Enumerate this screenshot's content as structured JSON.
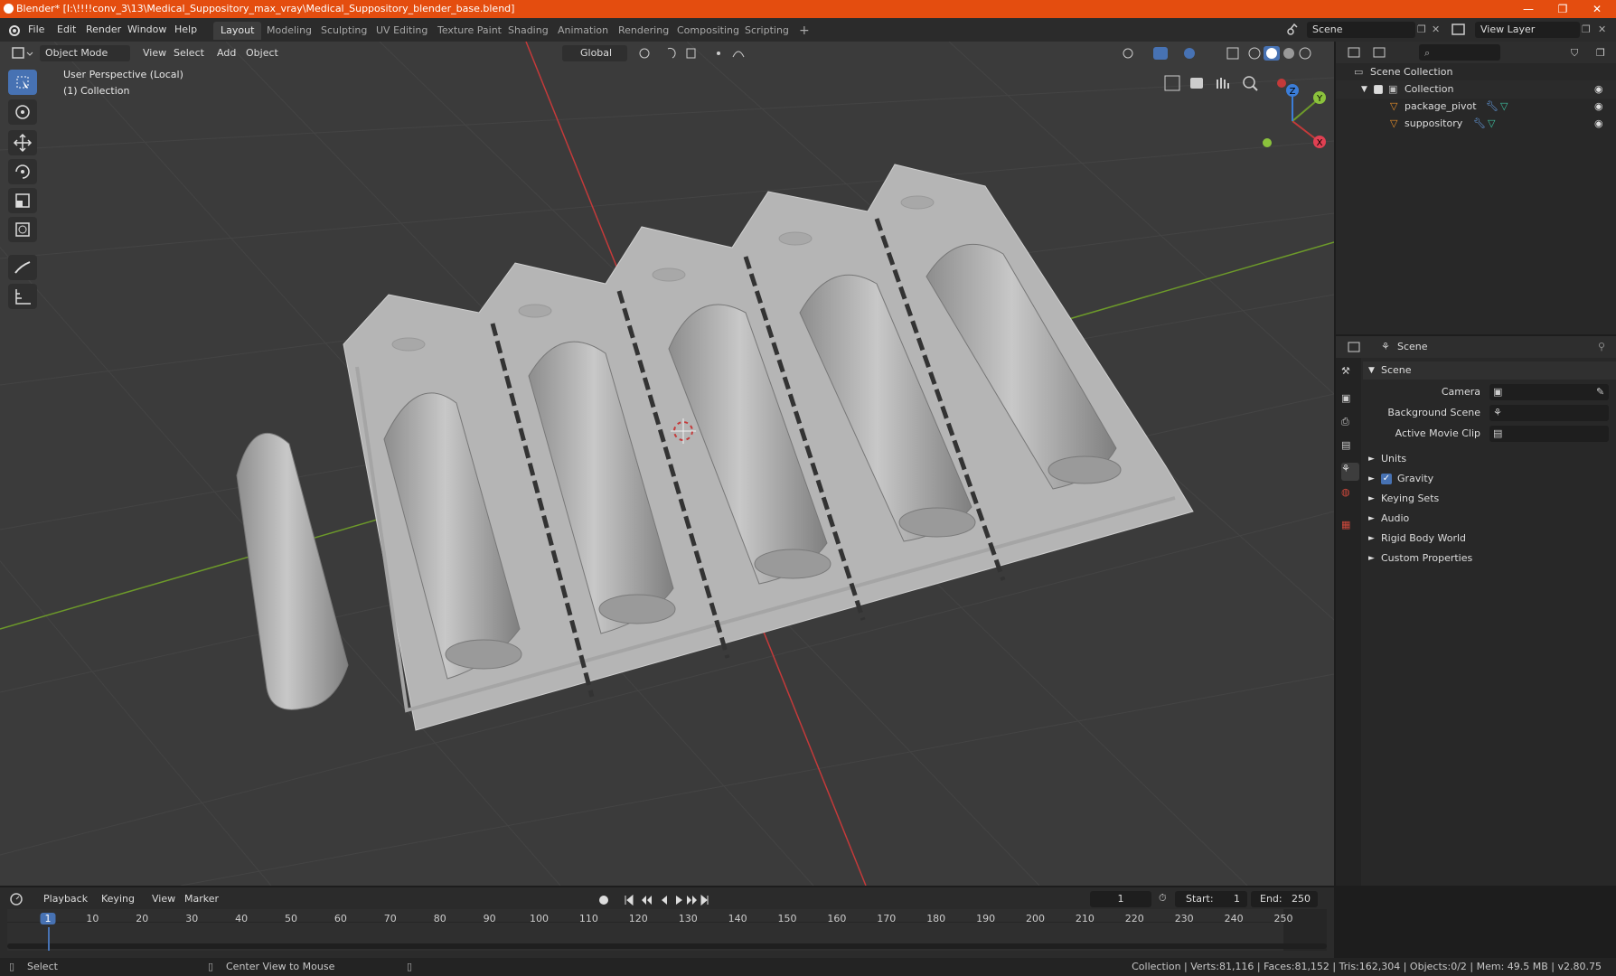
{
  "window": {
    "title": "Blender* [I:\\!!!!conv_3\\13\\Medical_Suppository_max_vray\\Medical_Suppository_blender_base.blend]",
    "controls": [
      "—",
      "❐",
      "✕"
    ]
  },
  "menu": {
    "items": [
      "File",
      "Edit",
      "Render",
      "Window",
      "Help"
    ],
    "workspaces": [
      "Layout",
      "Modeling",
      "Sculpting",
      "UV Editing",
      "Texture Paint",
      "Shading",
      "Animation",
      "Rendering",
      "Compositing",
      "Scripting"
    ],
    "active_workspace": "Layout",
    "add_workspace": "+",
    "scene_field": "Scene",
    "view_layer_field": "View Layer"
  },
  "viewport": {
    "mode": "Object Mode",
    "header_menus": [
      "View",
      "Select",
      "Add",
      "Object"
    ],
    "transform_orientation": "Global",
    "overlay_line1": "User Perspective (Local)",
    "overlay_line2": "(1) Collection",
    "gizmo_axes": [
      "X",
      "Y",
      "Z"
    ],
    "colors": {
      "background": "#3b3b3b",
      "grid": "#444444",
      "x_axis": "#c43a3a",
      "y_axis": "#6d9a2a",
      "mesh": "#b8b8b8",
      "accent": "#4772b3"
    }
  },
  "outliner": {
    "root": "Scene Collection",
    "collection": "Collection",
    "objects": [
      "package_pivot",
      "suppository"
    ]
  },
  "properties": {
    "header": "Scene",
    "section": "Scene",
    "fields": [
      {
        "label": "Camera",
        "value": ""
      },
      {
        "label": "Background Scene",
        "value": ""
      },
      {
        "label": "Active Movie Clip",
        "value": ""
      }
    ],
    "subpanels": [
      "Units",
      "Gravity",
      "Keying Sets",
      "Audio",
      "Rigid Body World",
      "Custom Properties"
    ],
    "gravity_checked": true
  },
  "timeline": {
    "menus": [
      "Playback",
      "Keying",
      "View",
      "Marker"
    ],
    "current_frame": "1",
    "start_label": "Start:",
    "start": "1",
    "end_label": "End:",
    "end": "250",
    "ticks": [
      "1",
      "10",
      "20",
      "30",
      "40",
      "50",
      "60",
      "70",
      "80",
      "90",
      "100",
      "110",
      "120",
      "130",
      "140",
      "150",
      "160",
      "170",
      "180",
      "190",
      "200",
      "210",
      "220",
      "230",
      "240",
      "250"
    ]
  },
  "statusbar": {
    "left": "Select",
    "middle": "Center View to Mouse",
    "right": "Collection | Verts:81,116 | Faces:81,152 | Tris:162,304 | Objects:0/2 | Mem: 49.5 MB | v2.80.75"
  }
}
